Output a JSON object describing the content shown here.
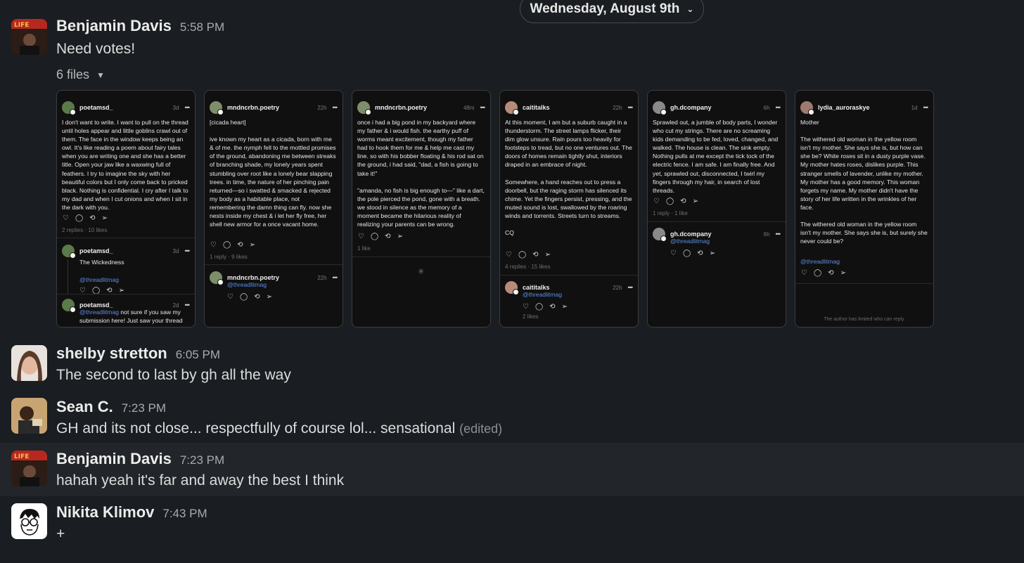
{
  "date_divider": {
    "label": "Wednesday, August 9th"
  },
  "messages": [
    {
      "name": "Benjamin Davis",
      "time": "5:58 PM",
      "text": "Need votes!"
    },
    {
      "name": "shelby stretton",
      "time": "6:05 PM",
      "text": "The second to last by gh all the way"
    },
    {
      "name": "Sean C.",
      "time": "7:23 PM",
      "text": "GH and its not close... respectfully of course lol... sensational",
      "edited": "(edited)"
    },
    {
      "name": "Benjamin Davis",
      "time": "7:23 PM",
      "text": "hahah yeah it's far and away the best I think"
    },
    {
      "name": "Nikita Klimov",
      "time": "7:43 PM",
      "text": "+"
    }
  ],
  "files": {
    "label": "6 files"
  },
  "icons": {
    "like": "heart-icon",
    "comment": "comment-icon",
    "repost": "repost-icon",
    "share": "share-icon",
    "more": "more-icon",
    "loading": "spinner-icon"
  },
  "cards": [
    {
      "user": "poetamsd_",
      "age": "3d",
      "body": "I don't want to write. I want to pull on the thread until holes appear and little goblins crawl out of them. The face in the window keeps being an owl. It's like reading a poem about fairy tales when you are writing one and she has a better title. Open your jaw like a waxwing full of feathers. I try to imagine the sky with her beautiful colors but I only come back to pricked black. Nothing is confidential. I cry after I talk to my dad and when I cut onions and when I sit in the dark with you.",
      "stats": "2 replies · 10 likes",
      "replies": [
        {
          "user": "poetamsd_",
          "age": "3d",
          "text": "The Wickedness",
          "mention": "@threadlitmag"
        },
        {
          "user": "poetamsd_",
          "age": "2d",
          "mention": "@threadlitmag",
          "text": " not sure if you saw my submission here! Just saw your thread"
        }
      ]
    },
    {
      "user": "mndncrbn.poetry",
      "age": "22h",
      "body": "[cicada heart]\n\nive known my heart as a cicada, born with me & of me. the nymph fell to the mottled promises of the ground, abandoning me between streaks of branching shade, my lonely years spent stumbling over root like a lonely bear slapping trees. in time, the nature of her pinching pain returned—so i swatted & smacked & rejected my body as a habitable place, not remembering the damn thing can fly. now she nests inside my chest & i let her fly free, her shell new armor for a once vacant home.",
      "stats": "1 reply · 9 likes",
      "replies": [
        {
          "user": "mndncrbn.poetry",
          "age": "22h",
          "mention": "@threadlitmag"
        }
      ]
    },
    {
      "user": "mndncrbn.poetry",
      "age": "48m",
      "body": "once i had a big pond in my backyard where my father & i would fish. the earthy puff of worms meant excitement, though my father had to hook them for me & help me cast my line. so with his bobber floating & his rod sat on the ground, i had said, \"dad, a fish is going to take it!\"\n\n\"amanda, no fish is big enough to—\" like a dart, the pole pierced the pond, gone with a breath. we stood in silence as the memory of a moment became the hilarious reality of realizing your parents can be wrong.",
      "stats": "1 like"
    },
    {
      "user": "caititalks",
      "age": "22h",
      "body": "At this moment, I am but a suburb caught in a thunderstorm. The street lamps flicker, their dim glow unsure. Rain pours too heavily for footsteps to tread, but no one ventures out. The doors of homes remain tightly shut, interiors draped in an embrace of night.\n\nSomewhere, a hand reaches out to press a doorbell, but the raging storm has silenced its chime. Yet the fingers persist, pressing, and the muted sound is lost, swallowed by the roaring winds and torrents. Streets turn to streams.\n\nCQ",
      "stats": "4 replies · 15 likes",
      "replies": [
        {
          "user": "caititalks",
          "age": "22h",
          "mention": "@threadlitmag",
          "stats": "2 likes"
        }
      ]
    },
    {
      "user": "gh.dcompany",
      "age": "6h",
      "body": "Sprawled out, a jumble of body parts, I wonder who cut my strings. There are no screaming kids demanding to be fed, loved, changed, and walked. The house is clean. The sink empty. Nothing pulls at me except the tick tock of the electric fence. I am safe. I am finally free. And yet, sprawled out, disconnected, I twirl my fingers through my hair, in search of lost threads.",
      "stats": "1 reply · 1 like",
      "replies": [
        {
          "user": "gh.dcompany",
          "age": "6h",
          "mention": "@threadlitmag"
        }
      ]
    },
    {
      "user": "lydia_auroraskye",
      "age": "1d",
      "body": "Mother\n\nThe withered old woman in the yellow room isn't my mother. She says she is, but how can she be? White roses sit in a dusty purple vase. My mother hates roses, dislikes purple. This stranger smells of lavender, unlike my mother. My mother has a good memory. This woman forgets my name. My mother didn't have the story of her life written in the wrinkles of her face.\n\nThe withered old woman in the yellow room isn't my mother. She says she is, but surely she never could be?",
      "mention": "@threadlitmag",
      "footer": "The author has limited who can reply."
    }
  ],
  "colors": {
    "background": "#1a1d21",
    "highlight": "#222529",
    "mention": "#5a8fe6"
  }
}
